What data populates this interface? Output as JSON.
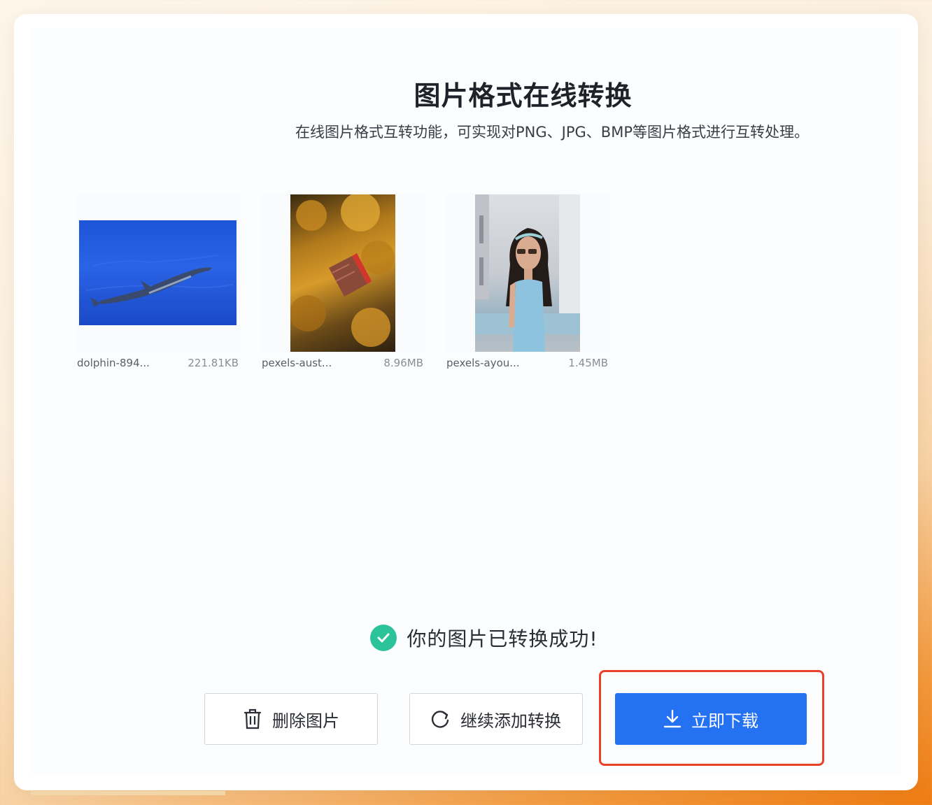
{
  "page": {
    "title": "图片格式在线转换",
    "subtitle": "在线图片格式互转功能，可实现对PNG、JPG、BMP等图片格式进行互转处理。"
  },
  "files": [
    {
      "name": "dolphin-894...",
      "size": "221.81KB",
      "thumb": "dolphin-photo"
    },
    {
      "name": "pexels-aust...",
      "size": "8.96MB",
      "thumb": "forest-house-photo"
    },
    {
      "name": "pexels-ayou...",
      "size": "1.45MB",
      "thumb": "woman-portrait-photo"
    }
  ],
  "status": {
    "icon": "check-circle-icon",
    "text": "你的图片已转换成功!"
  },
  "actions": {
    "delete": {
      "label": "删除图片",
      "icon": "trash-icon"
    },
    "continue": {
      "label": "继续添加转换",
      "icon": "refresh-icon"
    },
    "download": {
      "label": "立即下载",
      "icon": "download-icon"
    }
  },
  "colors": {
    "primary": "#2472f2",
    "success": "#2cc29a",
    "highlight": "#e8412c"
  }
}
